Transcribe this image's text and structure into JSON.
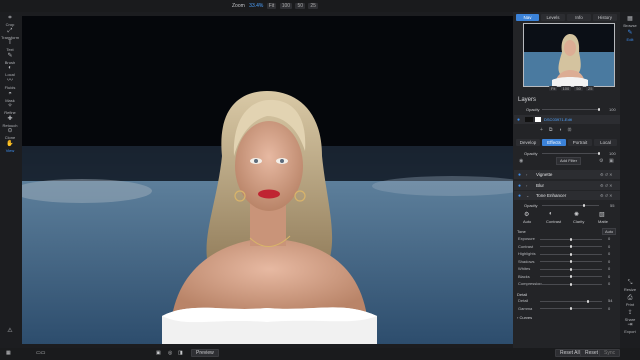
{
  "topbar": {
    "zoom_label": "Zoom",
    "zoom_pct": "33.4%",
    "zoom_buttons": [
      "Fit",
      "100",
      "50",
      "25"
    ]
  },
  "left_tools": [
    {
      "label": "Crop",
      "icon": "crop-icon",
      "glyph": "⌗"
    },
    {
      "label": "Transform",
      "icon": "transform-icon",
      "glyph": "⤢"
    },
    {
      "label": "Text",
      "icon": "text-icon",
      "glyph": "T"
    },
    {
      "label": "Brush",
      "icon": "brush-icon",
      "glyph": "✎"
    },
    {
      "label": "Local",
      "icon": "local-icon",
      "glyph": "◐"
    },
    {
      "label": "Fluids",
      "icon": "fluids-icon",
      "glyph": "〰"
    },
    {
      "label": "Mask",
      "icon": "mask-icon",
      "glyph": "◓"
    },
    {
      "label": "Refine",
      "icon": "refine-icon",
      "glyph": "✧"
    },
    {
      "label": "Retouch",
      "icon": "retouch-icon",
      "glyph": "✚"
    },
    {
      "label": "Clone",
      "icon": "clone-icon",
      "glyph": "⊙"
    },
    {
      "label": "View",
      "icon": "view-icon",
      "glyph": "✋",
      "active": true
    }
  ],
  "right_tabs": [
    "Nav",
    "Levels",
    "Info",
    "History"
  ],
  "right_tabs_active": "Nav",
  "navigator": {
    "buttons": [
      "Fit",
      "100",
      "50",
      "25"
    ]
  },
  "layers": {
    "title": "Layers",
    "opacity_label": "Opacity",
    "opacity_value": "100",
    "layer_name": "DSC03971-Edit"
  },
  "effects_tabs": [
    "Develop",
    "Effects",
    "Portrait",
    "Local"
  ],
  "effects_active": "Effects",
  "effects": {
    "opacity_label": "Opacity",
    "opacity_value": "100",
    "add_filter": "Add Filter",
    "filters": [
      "Vignette",
      "Blur",
      "Tone Enhancer"
    ]
  },
  "tone_enhancer": {
    "opacity_label": "Opacity",
    "opacity_value": "55",
    "presets": [
      "Auto",
      "Contrast",
      "Clarity",
      "Matte"
    ],
    "tone_label": "Tone",
    "tone_button": "Auto",
    "sliders": [
      {
        "label": "Exposure",
        "value": "0",
        "pos": 0.5
      },
      {
        "label": "Contrast",
        "value": "0",
        "pos": 0.5
      },
      {
        "label": "Highlights",
        "value": "0",
        "pos": 0.5
      },
      {
        "label": "Shadows",
        "value": "0",
        "pos": 0.5
      },
      {
        "label": "Whites",
        "value": "0",
        "pos": 0.5
      },
      {
        "label": "Blacks",
        "value": "0",
        "pos": 0.5
      },
      {
        "label": "Compression",
        "value": "0",
        "pos": 0.5
      }
    ],
    "detail_label": "Detail",
    "detail_sliders": [
      {
        "label": "Detail",
        "value": "54",
        "pos": 0.77
      },
      {
        "label": "Gamma",
        "value": "0",
        "pos": 0.5
      }
    ],
    "curves_label": "Curves"
  },
  "right_tools": [
    {
      "label": "Browse",
      "icon": "browse-icon",
      "glyph": "▦"
    },
    {
      "label": "Edit",
      "icon": "edit-icon",
      "glyph": "✎",
      "active": true
    },
    {
      "label": "Resize",
      "icon": "resize-icon",
      "glyph": "⤡"
    },
    {
      "label": "Print",
      "icon": "print-icon",
      "glyph": "⎙"
    },
    {
      "label": "Share",
      "icon": "share-icon",
      "glyph": "⇪"
    },
    {
      "label": "Export",
      "icon": "export-icon",
      "glyph": "⇥"
    }
  ],
  "bottombar": {
    "preview": "Preview",
    "reset_all": "Reset All",
    "reset": "Reset",
    "sync": "Sync"
  },
  "colors": {
    "accent": "#3b82d8",
    "panel": "#232427",
    "bg": "#1c1d20"
  }
}
